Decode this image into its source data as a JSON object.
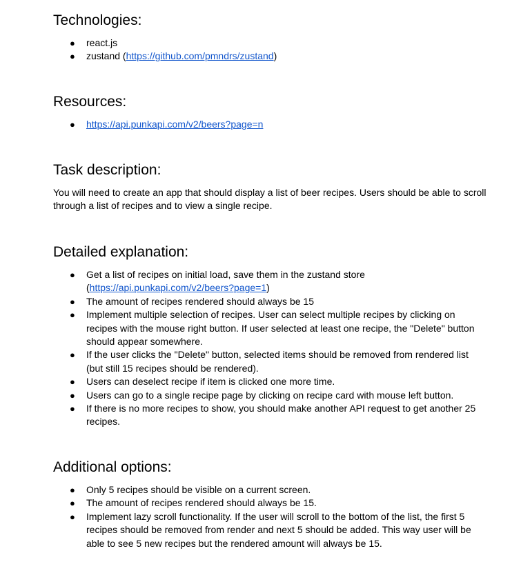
{
  "technologies": {
    "heading": "Technologies:",
    "items": [
      {
        "text": "react.js"
      },
      {
        "prefix": "zustand (",
        "link": "https://github.com/pmndrs/zustand",
        "suffix": ")"
      }
    ]
  },
  "resources": {
    "heading": "Resources:",
    "items": [
      {
        "link": "https://api.punkapi.com/v2/beers?page=n"
      }
    ]
  },
  "task": {
    "heading": "Task description:",
    "text": "You will need to create an app that should display a list of beer recipes. Users should be able to scroll through a list of recipes and to view a single recipe."
  },
  "detailed": {
    "heading": "Detailed explanation:",
    "items": [
      {
        "text": "Get a list of recipes on initial load, save them in the zustand store",
        "prefix": "(",
        "link": "https://api.punkapi.com/v2/beers?page=1",
        "suffix": ")"
      },
      {
        "text": "The amount of recipes rendered should always be 15"
      },
      {
        "text": "Implement multiple selection of recipes. User can select multiple recipes by clicking on recipes with the mouse right button. If user selected at least one recipe, the \"Delete\" button should appear somewhere."
      },
      {
        "text": "If the user clicks the \"Delete\" button, selected items should be removed from rendered list (but still 15 recipes should be rendered)."
      },
      {
        "text": "Users can deselect recipe if item is clicked one more time."
      },
      {
        "text": "Users can go to a single recipe page by clicking on recipe card with mouse left button."
      },
      {
        "text": "If there is no more recipes to show, you should make another API request to get another 25 recipes."
      }
    ]
  },
  "additional": {
    "heading": "Additional options:",
    "items": [
      {
        "text": "Only 5 recipes should be visible on a current screen."
      },
      {
        "text": "The amount of recipes rendered should always be 15."
      },
      {
        "text": "Implement lazy scroll functionality. If the user will scroll to the bottom of the list, the first 5 recipes should be removed from render and next 5 should be added. This way user will be able to see 5 new recipes but the rendered amount will always be 15."
      }
    ]
  },
  "bullet_glyph": "●"
}
